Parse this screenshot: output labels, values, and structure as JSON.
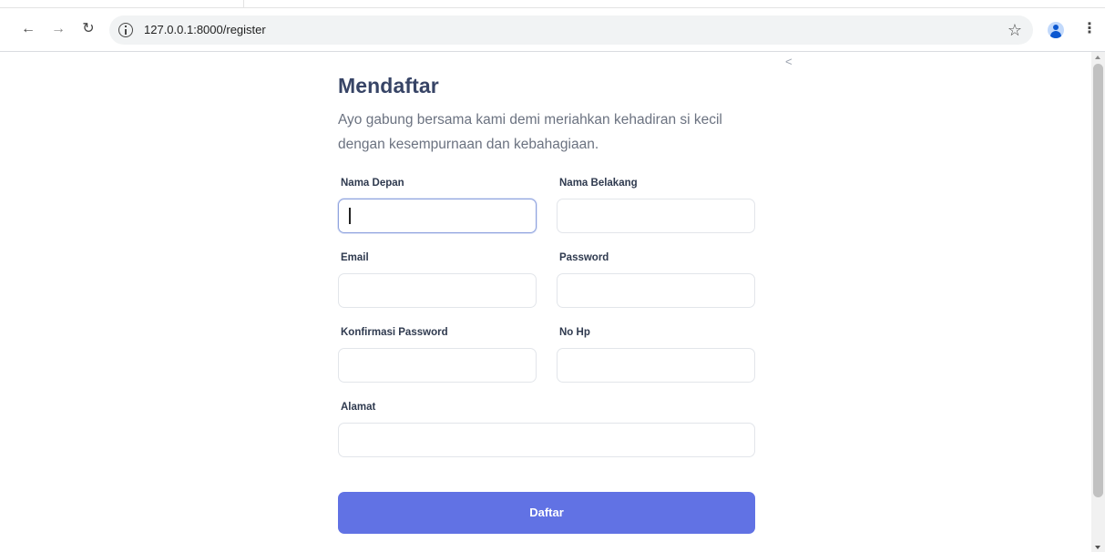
{
  "browser": {
    "url": "127.0.0.1:8000/register",
    "icons": {
      "back": "back-arrow-icon",
      "forward": "forward-arrow-icon",
      "reload": "reload-icon",
      "info": "info-icon",
      "bookmark": "star-icon",
      "profile": "avatar-icon",
      "menu": "kebab-menu-icon"
    }
  },
  "page": {
    "collapse_glyph": "<",
    "title": "Mendaftar",
    "subtitle": "Ayo gabung bersama kami demi meriahkan kehadiran si kecil dengan kesempurnaan dan kebahagiaan.",
    "fields": {
      "first_name": {
        "label": "Nama Depan",
        "value": ""
      },
      "last_name": {
        "label": "Nama Belakang",
        "value": ""
      },
      "email": {
        "label": "Email",
        "value": ""
      },
      "password": {
        "label": "Password",
        "value": ""
      },
      "confirm_password": {
        "label": "Konfirmasi Password",
        "value": ""
      },
      "phone": {
        "label": "No Hp",
        "value": ""
      },
      "address": {
        "label": "Alamat",
        "value": ""
      }
    },
    "submit_label": "Daftar"
  },
  "colors": {
    "accent": "#6172e4",
    "title": "#374466",
    "text_muted": "#6b7280",
    "focus_border": "#8ea2de"
  }
}
